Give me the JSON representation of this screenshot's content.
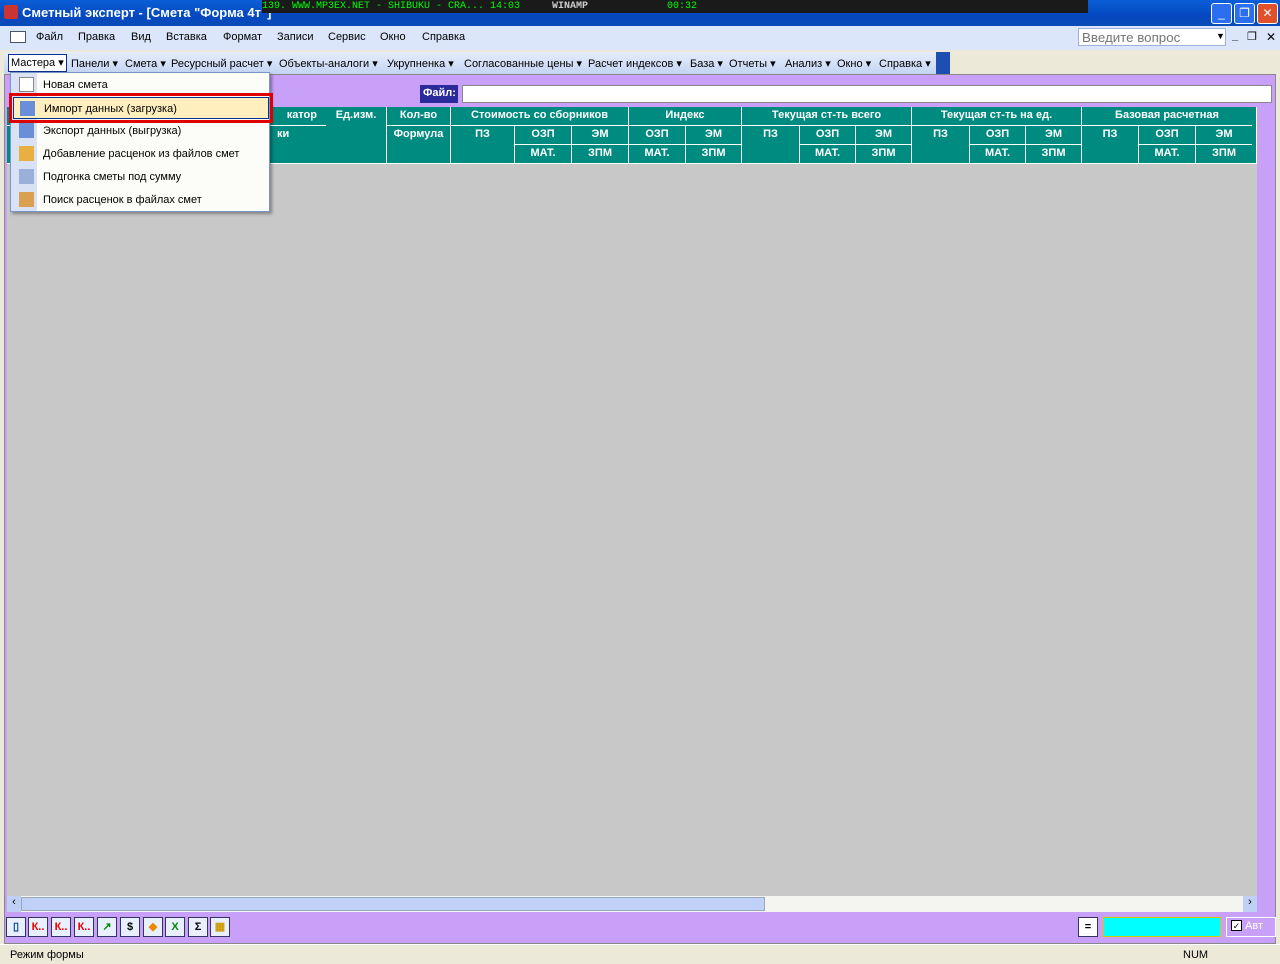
{
  "window": {
    "title": "Сметный эксперт - [Смета \"Форма 4т\"]",
    "winamp_text": "139. WWW.MP3EX.NET - SHIBUKU - CRA...  14:03",
    "winamp_label": "WINAMP",
    "winamp_time": "00:32"
  },
  "menubar": {
    "items": [
      "Файл",
      "Правка",
      "Вид",
      "Вставка",
      "Формат",
      "Записи",
      "Сервис",
      "Окно",
      "Справка"
    ],
    "help_placeholder": "Введите вопрос"
  },
  "toolbar": {
    "items": [
      "Мастера",
      "Панели",
      "Смета",
      "Ресурсный расчет",
      "Объекты-аналоги",
      "Укрупненка",
      "Согласованные цены",
      "Расчет индексов",
      "База",
      "Отчеты",
      "Анализ",
      "Окно",
      "Справка"
    ]
  },
  "dropdown": {
    "items": [
      "Новая смета",
      "Импорт данных (загрузка)",
      "Экспорт данных (выгрузка)",
      "Добавление расценок из файлов смет",
      "Подгонка сметы под сумму",
      "Поиск расценок в файлах смет"
    ]
  },
  "form": {
    "file_label": "Файл:",
    "file_value": ""
  },
  "table_header": {
    "partial_top": "катор",
    "partial_bottom": "ки",
    "unit": "Ед.изм.",
    "qty": "Кол-во",
    "formula": "Формула",
    "groups": [
      "Стоимость со сборников",
      "Индекс",
      "Текущая ст-ть всего",
      "Текущая ст-ть на ед.",
      "Базовая расчетная"
    ],
    "pz": "ПЗ",
    "ozp": "ОЗП",
    "em": "ЭМ",
    "mat": "МАТ.",
    "zpm": "ЗПМ"
  },
  "bottom": {
    "buttons": [
      "К..",
      "К..",
      "К.."
    ],
    "auto_label": "Авт",
    "auto_checked": true
  },
  "status": {
    "mode": "Режим формы",
    "num": "NUM"
  }
}
